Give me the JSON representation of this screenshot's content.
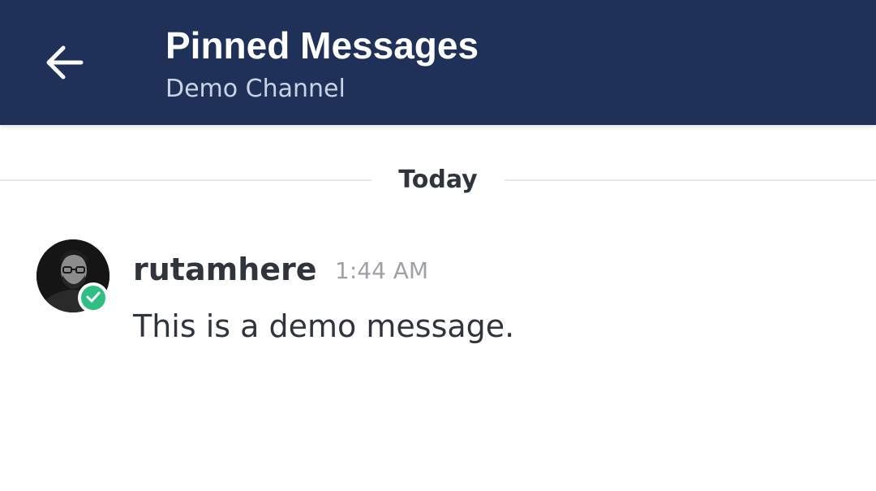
{
  "header": {
    "back_icon": "arrow-left-icon",
    "title": "Pinned Messages",
    "subtitle": "Demo Channel",
    "background_color": "#1f3158"
  },
  "date_divider": {
    "label": "Today"
  },
  "messages": [
    {
      "username": "rutamhere",
      "timestamp": "1:44 AM",
      "text": "This is a demo message.",
      "status": "online",
      "status_icon": "check-icon",
      "status_color": "#2fbf84"
    }
  ]
}
